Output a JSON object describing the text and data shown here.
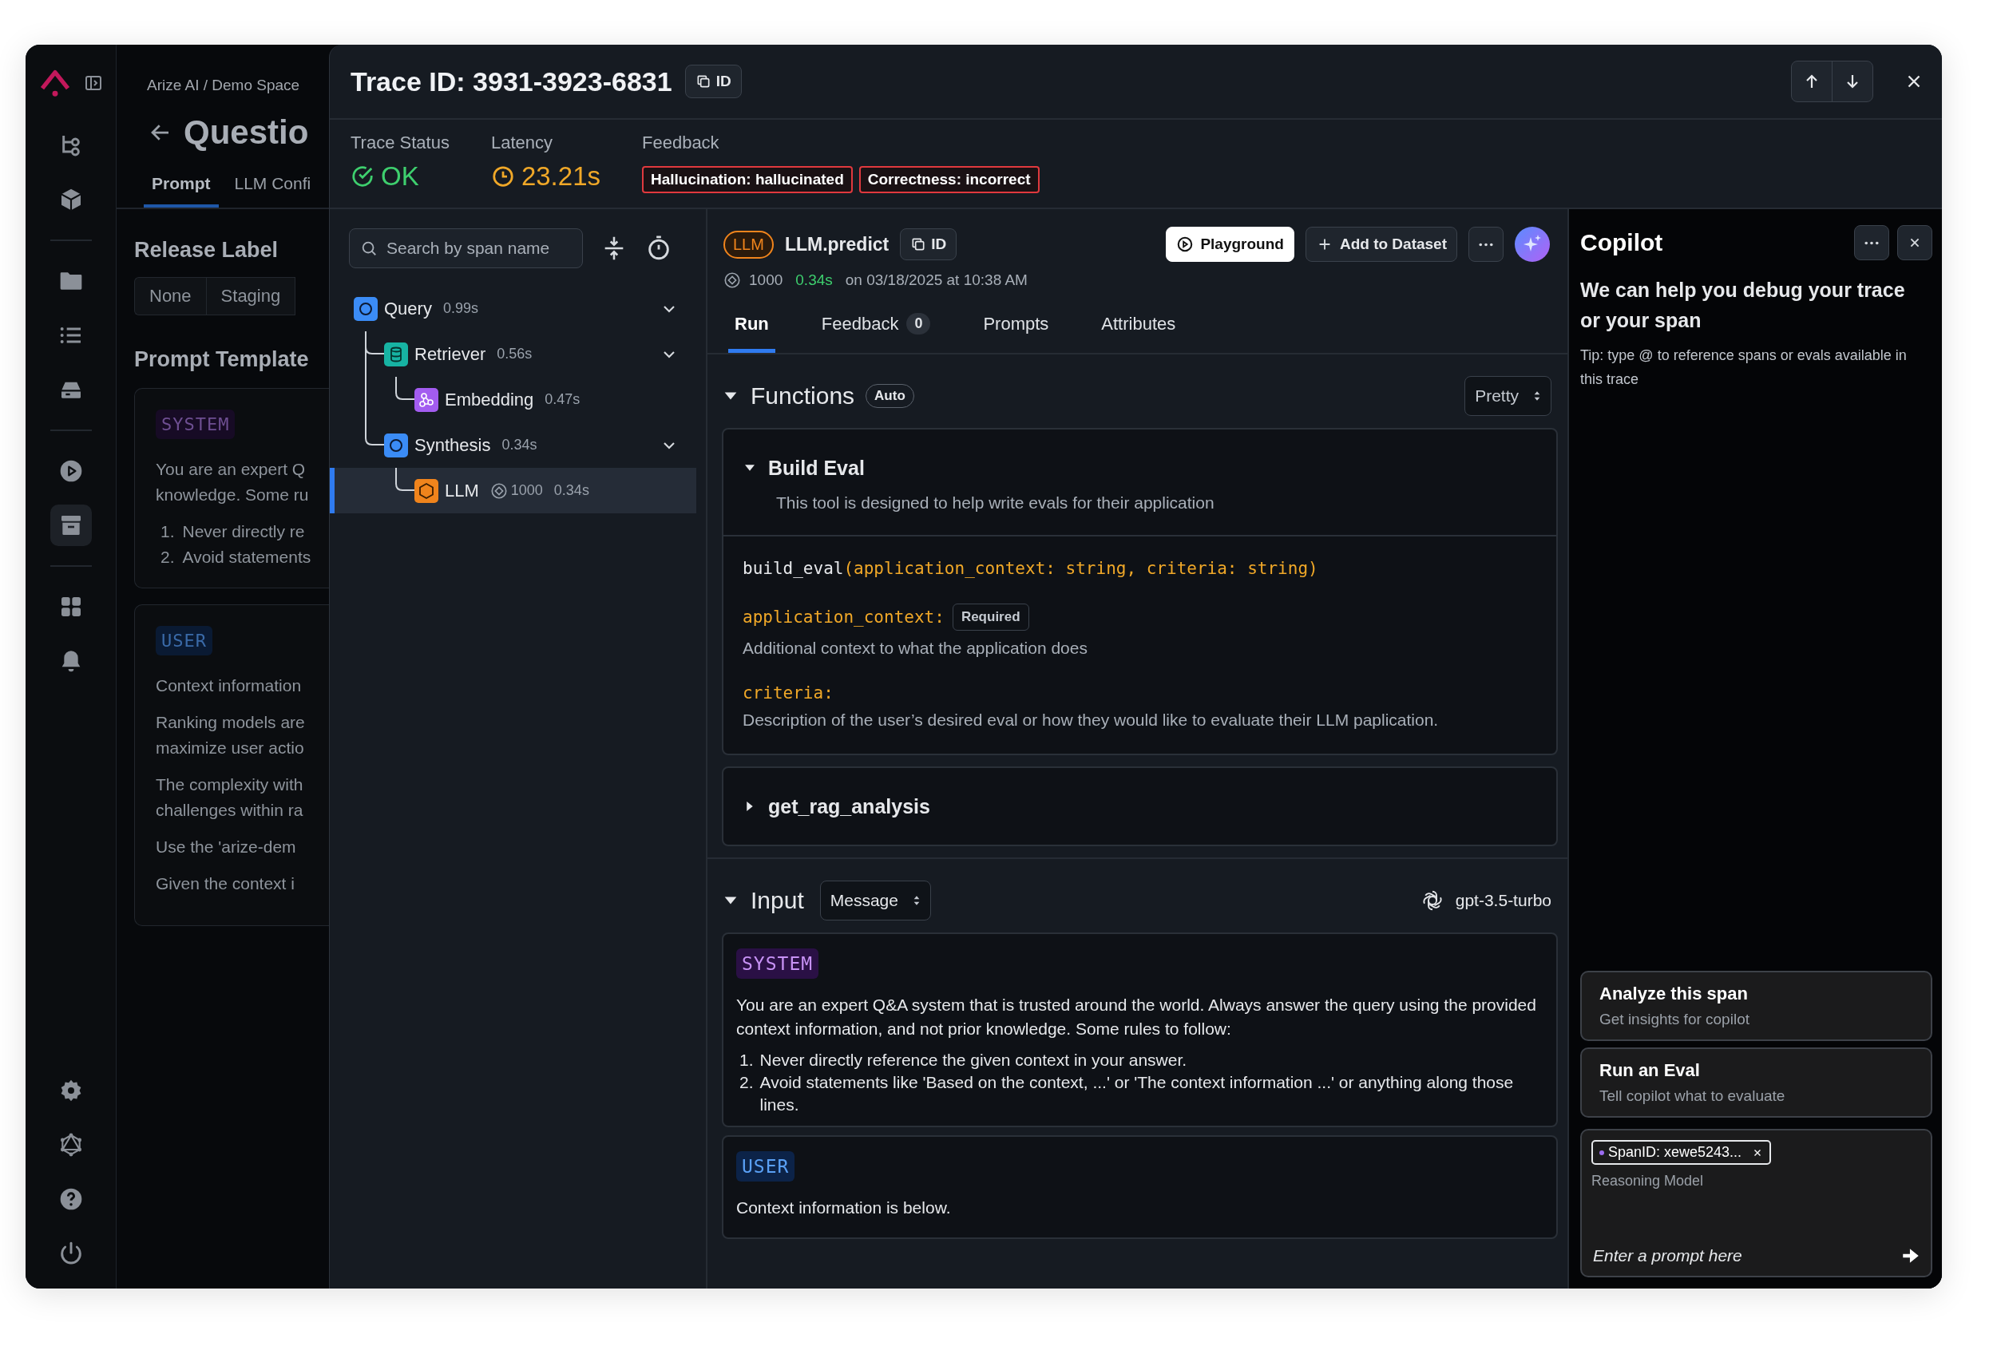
{
  "rail": {
    "groups": [
      [
        {
          "kind": "tree",
          "selected": false
        },
        {
          "kind": "cube",
          "selected": false
        }
      ],
      [
        {
          "kind": "folder",
          "selected": false
        },
        {
          "kind": "list",
          "selected": false
        },
        {
          "kind": "drive",
          "selected": false
        }
      ],
      [
        {
          "kind": "play",
          "selected": false
        },
        {
          "kind": "archive",
          "selected": true
        }
      ],
      [
        {
          "kind": "grid",
          "selected": false
        },
        {
          "kind": "bell",
          "selected": false
        }
      ]
    ],
    "footer": [
      {
        "kind": "gear",
        "selected": false
      },
      {
        "kind": "graph",
        "selected": false
      },
      {
        "kind": "help",
        "selected": false
      },
      {
        "kind": "power",
        "selected": false
      }
    ]
  },
  "background_page": {
    "breadcrumb": "Arize AI / Demo Space",
    "title": "Questio",
    "tabs": [
      {
        "label": "Prompt",
        "selected": true
      },
      {
        "label": "LLM Confi",
        "selected": false
      }
    ],
    "release_label": {
      "title": "Release Label",
      "options": [
        {
          "label": "None",
          "selected": false
        },
        {
          "label": "Staging",
          "selected": false
        }
      ]
    },
    "prompt_template": {
      "title": "Prompt Template",
      "messages": [
        {
          "role": "SYSTEM",
          "kind": "system",
          "paragraphs": [
            [
              "You are an expert Q",
              "knowledge. Some ru"
            ]
          ],
          "list": [
            {
              "number": "1.",
              "text": "Never directly re"
            },
            {
              "number": "2.",
              "text": "Avoid statements"
            }
          ]
        },
        {
          "role": "USER",
          "kind": "user",
          "paragraphs": [
            [
              "Context information"
            ],
            [
              "Ranking models are",
              "maximize user actio"
            ],
            [
              "The complexity with",
              "challenges within ra"
            ],
            [
              "Use the 'arize-dem"
            ],
            [
              "Given the context i"
            ]
          ]
        }
      ]
    }
  },
  "trace": {
    "title": "Trace ID: 3931-3923-6831",
    "id_button": "ID",
    "stats": [
      {
        "label": "Trace Status",
        "value": "OK",
        "kind": "status"
      },
      {
        "label": "Latency",
        "value": "23.21s",
        "kind": "latency"
      }
    ],
    "feedback": {
      "label": "Feedback",
      "tags": [
        "Hallucination: hallucinated",
        "Correctness: incorrect"
      ]
    }
  },
  "span_tree": {
    "search": {
      "placeholder": "Search by span name"
    },
    "spans": [
      {
        "name": "Query",
        "kind": "chain",
        "duration": "0.99s",
        "expanded": true,
        "selected": false,
        "children": [
          {
            "name": "Retriever",
            "kind": "retriever",
            "duration": "0.56s",
            "expanded": true,
            "selected": false,
            "children": [
              {
                "name": "Embedding",
                "kind": "embedding",
                "duration": "0.47s",
                "selected": false
              }
            ]
          },
          {
            "name": "Synthesis",
            "kind": "chain",
            "duration": "0.34s",
            "expanded": true,
            "selected": false,
            "children": [
              {
                "name": "LLM",
                "kind": "llm",
                "tokens": "1000",
                "duration": "0.34s",
                "selected": true
              }
            ]
          }
        ]
      }
    ]
  },
  "span": {
    "kind_badge": "LLM",
    "name": "LLM.predict",
    "id_button": "ID",
    "actions": [
      "Playground",
      "Add to Dataset"
    ],
    "tokens": "1000",
    "latency": "0.34s",
    "timestamp": "on 03/18/2025 at 10:38 AM",
    "tabs": [
      {
        "label": "Run",
        "selected": true
      },
      {
        "label": "Feedback",
        "count": "0",
        "selected": false
      },
      {
        "label": "Prompts",
        "selected": false
      },
      {
        "label": "Attributes",
        "selected": false
      }
    ],
    "functions": {
      "title": "Functions",
      "badge": "Auto",
      "expanded": true,
      "format": "Pretty",
      "items": [
        {
          "name": "Build Eval",
          "expanded": true,
          "description": "This tool is designed to help write evals for their application",
          "signature_name": "build_eval",
          "signature_params": "(application_context: string, criteria: string)",
          "params": [
            {
              "name": "application_context:",
              "badge": "Required",
              "description": "Additional context to what the application does"
            },
            {
              "name": "criteria:",
              "description": "Description of the user’s desired eval or how they would like to evaluate their LLM paplication."
            }
          ]
        },
        {
          "name": "get_rag_analysis",
          "expanded": false
        }
      ]
    },
    "input": {
      "title": "Input",
      "expanded": true,
      "format": "Message",
      "model": "gpt-3.5-turbo",
      "messages": [
        {
          "role": "SYSTEM",
          "kind": "system",
          "paragraphs": [
            "You are an expert Q&A system that is trusted around the world. Always answer the query using the provided context information, and not prior knowledge. Some rules to follow:"
          ],
          "list": [
            {
              "number": "1.",
              "text": "Never directly reference the given context in your answer."
            },
            {
              "number": "2.",
              "text": "Avoid statements like 'Based on the context, ...' or 'The context information ...' or anything along those lines."
            }
          ]
        },
        {
          "role": "USER",
          "kind": "user",
          "paragraphs": [
            "Context information is below."
          ]
        }
      ]
    }
  },
  "copilot": {
    "title": "Copilot",
    "heading": "We can help you debug your trace or your span",
    "tip": "Tip: type @ to reference spans or evals available in this trace",
    "suggestions": [
      {
        "title": "Analyze this span",
        "subtitle": "Get insights for copilot"
      },
      {
        "title": "Run an Eval",
        "subtitle": "Tell copilot what to evaluate"
      }
    ],
    "composer": {
      "chip": "SpanID: xewe5243...",
      "model": "Reasoning Model",
      "placeholder": "Enter a prompt here"
    }
  }
}
